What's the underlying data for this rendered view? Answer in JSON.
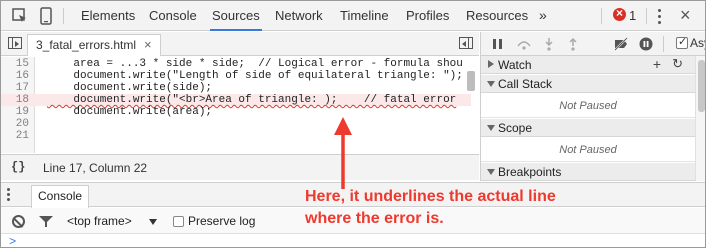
{
  "toolbar": {
    "tabs": [
      "Elements",
      "Console",
      "Sources",
      "Network",
      "Timeline",
      "Profiles",
      "Resources"
    ],
    "active_tab": "Sources",
    "more_tabs_glyph": "»",
    "error_count": "1",
    "close_glyph": "×"
  },
  "editor": {
    "file_tab": "3_fatal_errors.html",
    "file_tab_close": "×",
    "lines": [
      {
        "num": "15",
        "code": "    area = ...3 * side * side;  // Logical error - formula shou"
      },
      {
        "num": "16",
        "code": "    document.write(\"Length of side of equilateral triangle: \");"
      },
      {
        "num": "17",
        "code": "    document.write(side);"
      },
      {
        "num": "18",
        "code": "    document.write(\"<br>Area of triangle: );    // fatal error"
      },
      {
        "num": "19",
        "code": "    document.write(area);"
      },
      {
        "num": "20",
        "code": ""
      },
      {
        "num": "21",
        "code": ""
      }
    ],
    "error_line_index": 3
  },
  "status": {
    "curly_glyph": "{}",
    "cursor": "Line 17, Column 22"
  },
  "debugger": {
    "async_label": "Async",
    "sections": [
      {
        "label": "Watch",
        "body": ""
      },
      {
        "label": "Call Stack",
        "body": "Not Paused"
      },
      {
        "label": "Scope",
        "body": "Not Paused"
      },
      {
        "label": "Breakpoints",
        "body": ""
      }
    ],
    "add_glyph": "+",
    "refresh_glyph": "↻"
  },
  "drawer": {
    "tab": "Console",
    "frame_select": "<top frame>",
    "preserve_log": "Preserve log",
    "prompt": ">"
  },
  "annotation": {
    "text": "Here, it underlines the actual line where the error is.",
    "color": "#ee3a2e"
  }
}
